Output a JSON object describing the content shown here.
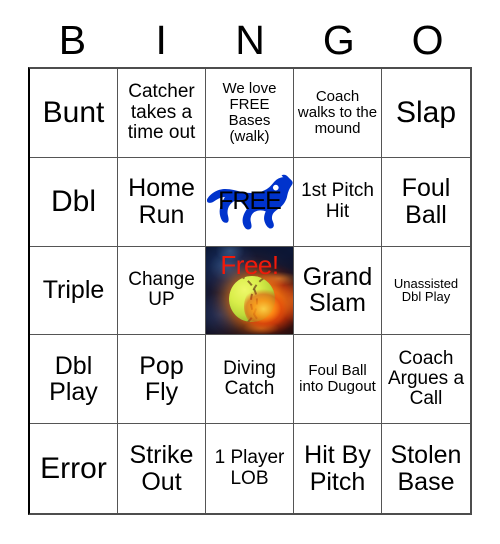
{
  "card": {
    "title": "BINGO",
    "headers": [
      "B",
      "I",
      "N",
      "G",
      "O"
    ],
    "colors": {
      "grid_border": "#555555",
      "text": "#000000",
      "free_center_text": "#f01a0a",
      "mustang_blue": "#0033cc",
      "background": "#ffffff"
    },
    "rows": [
      [
        {
          "text": "Bunt",
          "size": "fs-xl"
        },
        {
          "text": "Catcher takes a time out",
          "size": "fs-md"
        },
        {
          "text": "We love FREE Bases (walk)",
          "size": "fs-sm"
        },
        {
          "text": "Coach walks to the mound",
          "size": "fs-sm"
        },
        {
          "text": "Slap",
          "size": "fs-xl"
        }
      ],
      [
        {
          "text": "Dbl",
          "size": "fs-xl"
        },
        {
          "text": "Home Run",
          "size": "fs-lg"
        },
        {
          "text": "FREE",
          "size": "fs-lg",
          "type": "mustang-free"
        },
        {
          "text": "1st Pitch Hit",
          "size": "fs-md"
        },
        {
          "text": "Foul Ball",
          "size": "fs-lg"
        }
      ],
      [
        {
          "text": "Triple",
          "size": "fs-lg"
        },
        {
          "text": "Change UP",
          "size": "fs-md"
        },
        {
          "text": "Free!",
          "size": "fs-lg",
          "type": "fireball-free"
        },
        {
          "text": "Grand Slam",
          "size": "fs-lg"
        },
        {
          "text": "Unassisted Dbl Play",
          "size": "fs-xs"
        }
      ],
      [
        {
          "text": "Dbl Play",
          "size": "fs-lg"
        },
        {
          "text": "Pop Fly",
          "size": "fs-lg"
        },
        {
          "text": "Diving Catch",
          "size": "fs-md"
        },
        {
          "text": "Foul Ball into Dugout",
          "size": "fs-sm"
        },
        {
          "text": "Coach Argues a Call",
          "size": "fs-md"
        }
      ],
      [
        {
          "text": "Error",
          "size": "fs-xl"
        },
        {
          "text": "Strike Out",
          "size": "fs-lg"
        },
        {
          "text": "1 Player LOB",
          "size": "fs-md"
        },
        {
          "text": "Hit By Pitch",
          "size": "fs-lg"
        },
        {
          "text": "Stolen Base",
          "size": "fs-lg"
        }
      ]
    ]
  }
}
